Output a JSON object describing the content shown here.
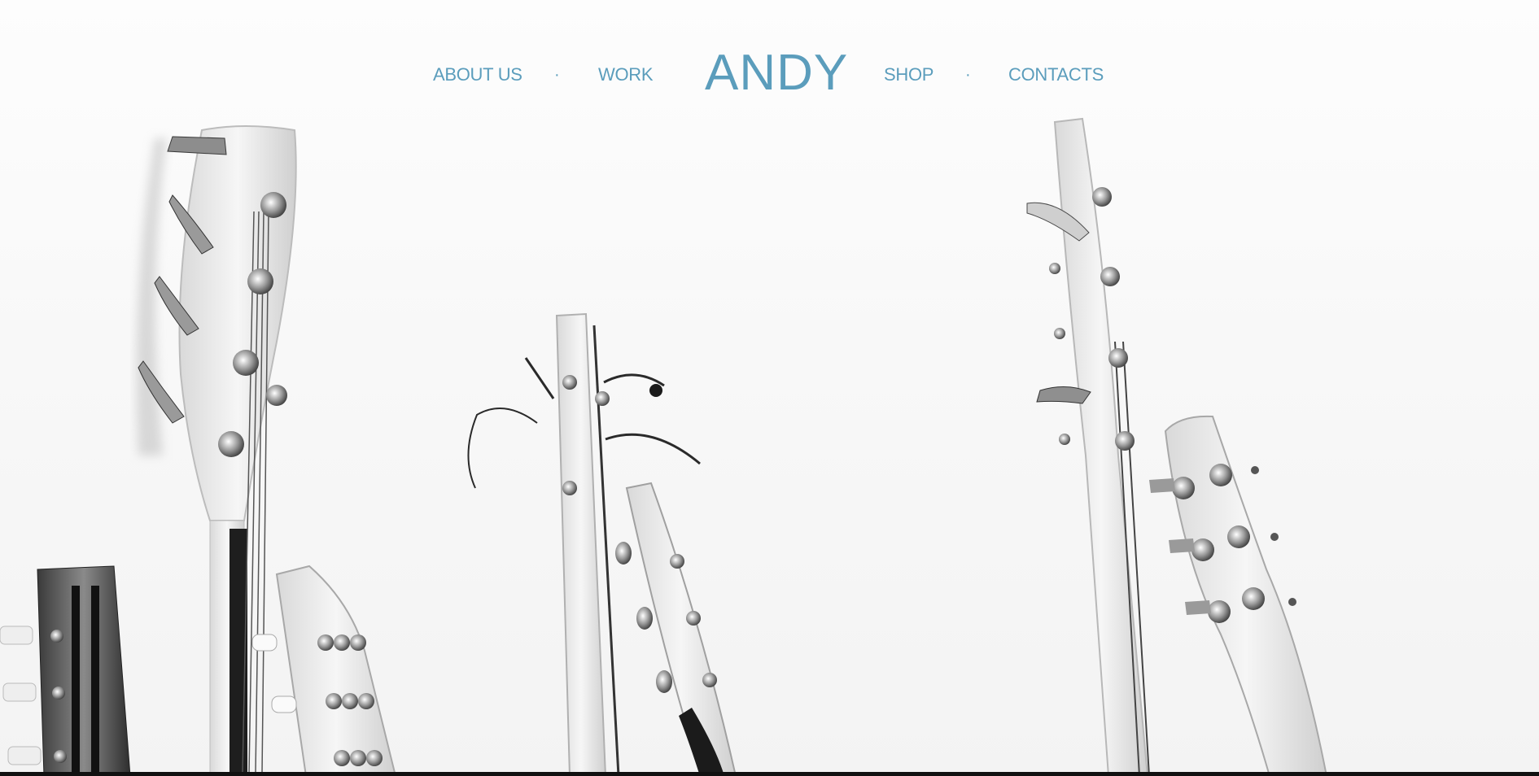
{
  "nav": {
    "about_label": "ABOUT US",
    "work_label": "WORK",
    "brand": "ANDY",
    "shop_label": "SHOP",
    "contacts_label": "CONTACTS",
    "separator": "·"
  },
  "hero": {
    "image_subject": "guitar-headstocks-photo"
  },
  "colors": {
    "accent": "#5b9dbc",
    "background": "#f7f7f7",
    "bottom_bar": "#111111"
  }
}
